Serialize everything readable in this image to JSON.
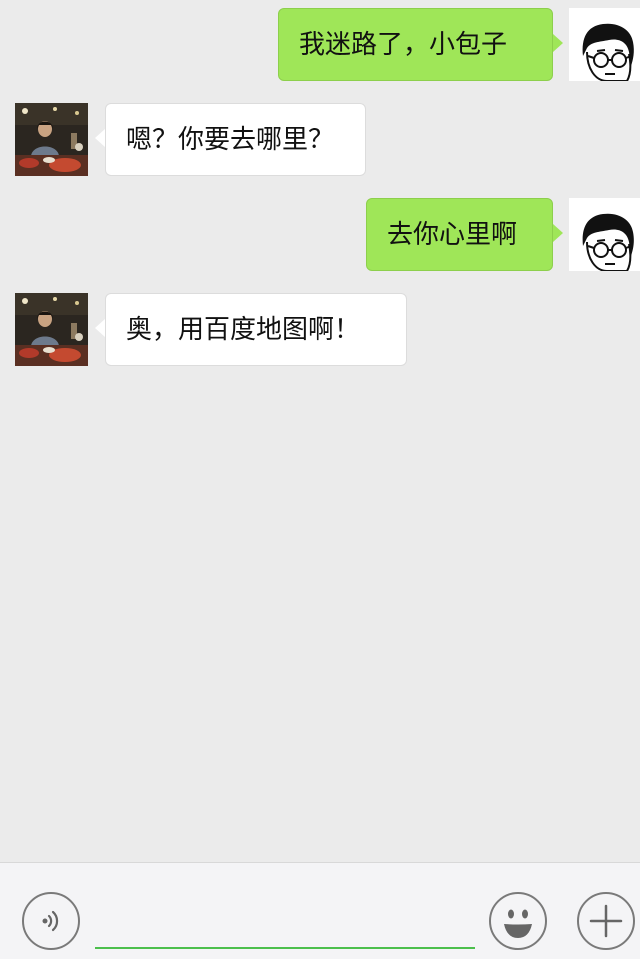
{
  "messages": [
    {
      "direction": "outgoing",
      "text": "我迷路了，小包子",
      "avatar_icon": "cartoon-face-with-glasses-icon"
    },
    {
      "direction": "incoming",
      "text": "嗯？你要去哪里？",
      "avatar_icon": "person-photo-avatar"
    },
    {
      "direction": "outgoing",
      "text": "去你心里啊",
      "avatar_icon": "cartoon-face-with-glasses-icon"
    },
    {
      "direction": "incoming",
      "text": "奥，用百度地图啊！",
      "avatar_icon": "person-photo-avatar"
    }
  ],
  "input_bar": {
    "message_value": "",
    "voice_icon": "voice-icon",
    "emoji_icon": "emoji-icon",
    "plus_icon": "plus-icon"
  },
  "colors": {
    "chat_background": "#ebebeb",
    "outgoing_bubble": "#9fe658",
    "incoming_bubble": "#ffffff",
    "input_underline": "#4cbf4c",
    "toolbar_background": "#f4f4f6"
  }
}
